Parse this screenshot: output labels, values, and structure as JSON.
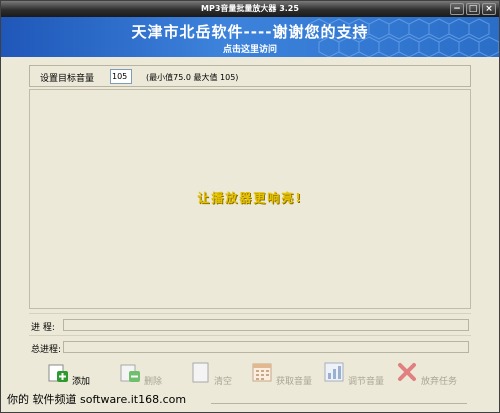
{
  "window": {
    "title": "MP3音量批量放大器   3.25",
    "controls": {
      "minimize": "−",
      "maximize": "□",
      "close": "×"
    }
  },
  "banner": {
    "headline": "天津市北岳软件----谢谢您的支持",
    "link_text": "点击这里访问"
  },
  "volume": {
    "label": "设置目标音量",
    "value": "105",
    "hint": "(最小值75.0  最大值 105)"
  },
  "content": {
    "slogan": "让播放器更响亮!"
  },
  "progress": {
    "current_label": "进  程:",
    "total_label": "总进程:",
    "current_value": 0,
    "total_value": 0
  },
  "toolbar": {
    "items": [
      {
        "label": "添加",
        "icon": "add-icon",
        "enabled": true
      },
      {
        "label": "删除",
        "icon": "delete-icon",
        "enabled": false
      },
      {
        "label": "清空",
        "icon": "clear-icon",
        "enabled": false
      },
      {
        "label": "获取音量",
        "icon": "calendar-icon",
        "enabled": false
      },
      {
        "label": "调节音量",
        "icon": "adjust-icon",
        "enabled": false
      },
      {
        "label": "放弃任务",
        "icon": "cancel-icon",
        "enabled": false
      }
    ]
  },
  "watermark": "你的 软件频道 software.it168.com",
  "colors": {
    "banner_blue": "#2a6ec8",
    "slogan_yellow": "#e6c200",
    "window_bg": "#ece9d8"
  }
}
